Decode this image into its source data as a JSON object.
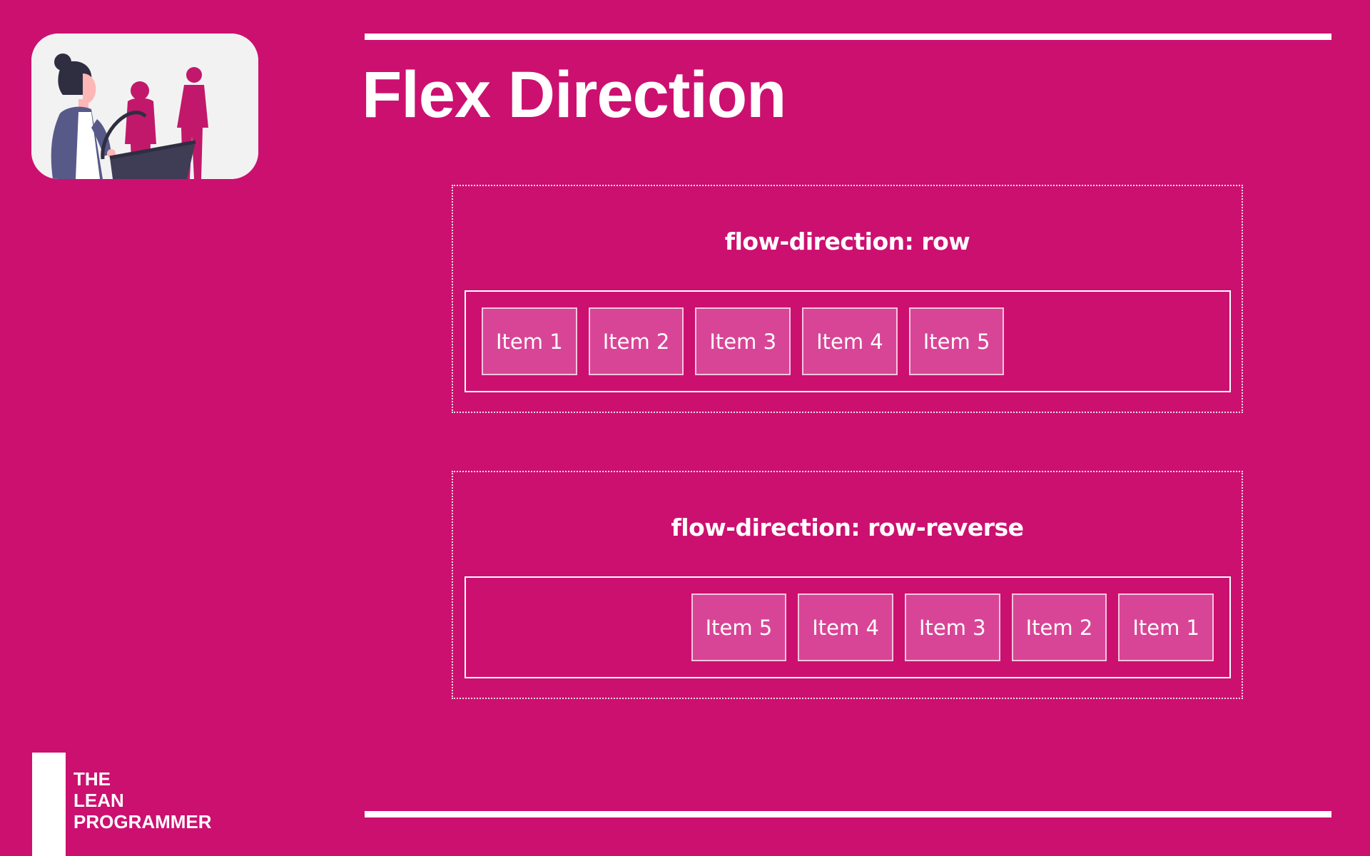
{
  "page": {
    "title": "Flex Direction"
  },
  "illustration": {
    "icon": "people-shopping-illustration-icon"
  },
  "demos": [
    {
      "label": "flow-direction: row",
      "items": [
        "Item 1",
        "Item 2",
        "Item 3",
        "Item 4",
        "Item 5"
      ]
    },
    {
      "label": "flow-direction: row-reverse",
      "items": [
        "Item 1",
        "Item 2",
        "Item 3",
        "Item 4",
        "Item 5"
      ]
    }
  ],
  "brand": {
    "line1": "THE",
    "line2": "LEAN",
    "line3": "PROGRAMMER"
  },
  "colors": {
    "background": "#cc1070",
    "item_fill": "#d94596",
    "line": "#ffffff"
  }
}
